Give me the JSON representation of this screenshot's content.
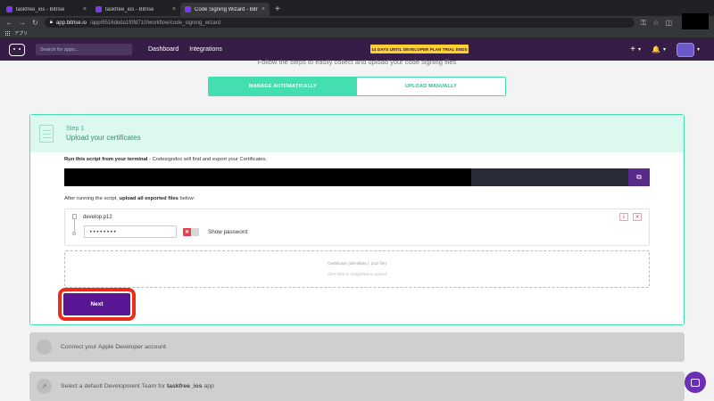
{
  "browser": {
    "tabs": [
      {
        "label": "taskfree_ios - Bitrise",
        "close": "×"
      },
      {
        "label": "taskfree_ios - Bitrise",
        "close": "×"
      },
      {
        "label": "Code Signing Wizard - Bitrise",
        "close": "×"
      }
    ],
    "new_tab": "+",
    "url_host": "app.bitrise.io",
    "url_path": "/app/6516deda1f0fd710/workflow/code_signing_wizard",
    "bookmark_label": "アプリ"
  },
  "appnav": {
    "search_placeholder": "Search for apps...",
    "links": [
      "Dashboard",
      "Integrations"
    ],
    "trial_badge": "14 DAYS UNTIL DEVELOPER PLAN TRIAL ENDS",
    "plus": "+",
    "bell": "🔔"
  },
  "wizard": {
    "subtitle": "Follow the steps to easily collect and upload your code signing files",
    "tabs": {
      "manage_auto": "MANAGE AUTOMATICALLY",
      "upload_manual": "UPLOAD MANUALLY"
    },
    "step1": {
      "number": "Step 1",
      "title": "Upload your certificates",
      "script_bold": "Run this script from your terminal",
      "script_rest": " - Codesigndoc will find and export your Certificates.",
      "after_pre": "After running the script, ",
      "after_bold": "upload all exported files",
      "after_post": " below:",
      "file_name": "develop.p12",
      "password_value": "••••••••",
      "toggle_x": "✕",
      "show_password": "Show password",
      "dropzone_title": "Certificate (Identities | .p12 file)",
      "dropzone_hint": "Click here or Drag&Drop to upload",
      "next": "Next"
    },
    "step2": {
      "label": "Connect your Apple Developer account"
    },
    "step3": {
      "label_pre": "Select a default Development Team for ",
      "label_bold": "taskfree_ios",
      "label_post": " app"
    }
  },
  "colors": {
    "accent": "#43dfb0",
    "brand": "#5b1696",
    "nav": "#351d48",
    "highlight": "#ef2b1b",
    "trial": "#ffd02e"
  }
}
